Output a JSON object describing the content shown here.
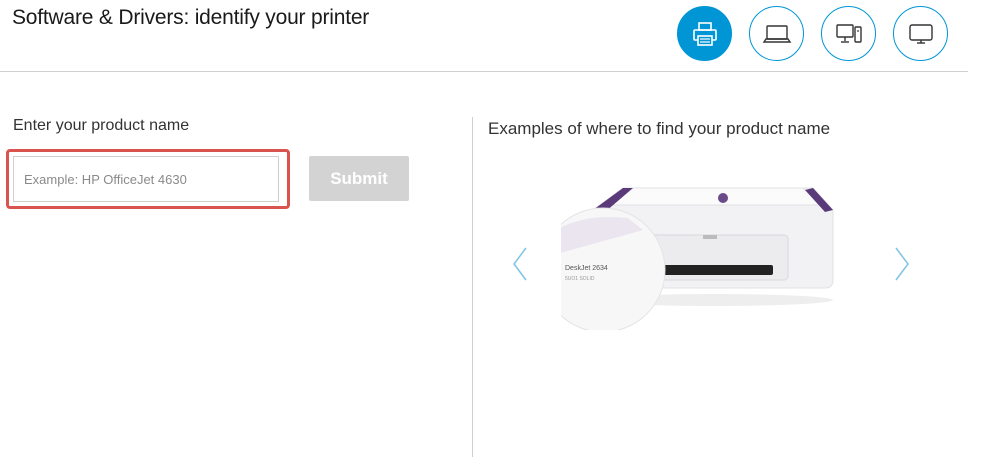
{
  "page": {
    "title": "Software & Drivers: identify your printer"
  },
  "device_types": [
    {
      "name": "printer",
      "icon": "printer-icon",
      "active": true
    },
    {
      "name": "laptop",
      "icon": "laptop-icon",
      "active": false
    },
    {
      "name": "desktop",
      "icon": "desktop-icon",
      "active": false
    },
    {
      "name": "monitor",
      "icon": "monitor-icon",
      "active": false
    }
  ],
  "form": {
    "label": "Enter your product name",
    "input_value": "",
    "input_placeholder": "Example: HP OfficeJet 4630",
    "submit_label": "Submit"
  },
  "examples": {
    "title": "Examples of where to find your product name",
    "image_label_line1": "DeskJet 2634",
    "image_label_line2": "5UO1 SOLID"
  },
  "colors": {
    "accent": "#0096d6",
    "highlight": "#d9534f",
    "submit_disabled": "#d3d3d3",
    "printer_trim": "#5b3a7a"
  }
}
